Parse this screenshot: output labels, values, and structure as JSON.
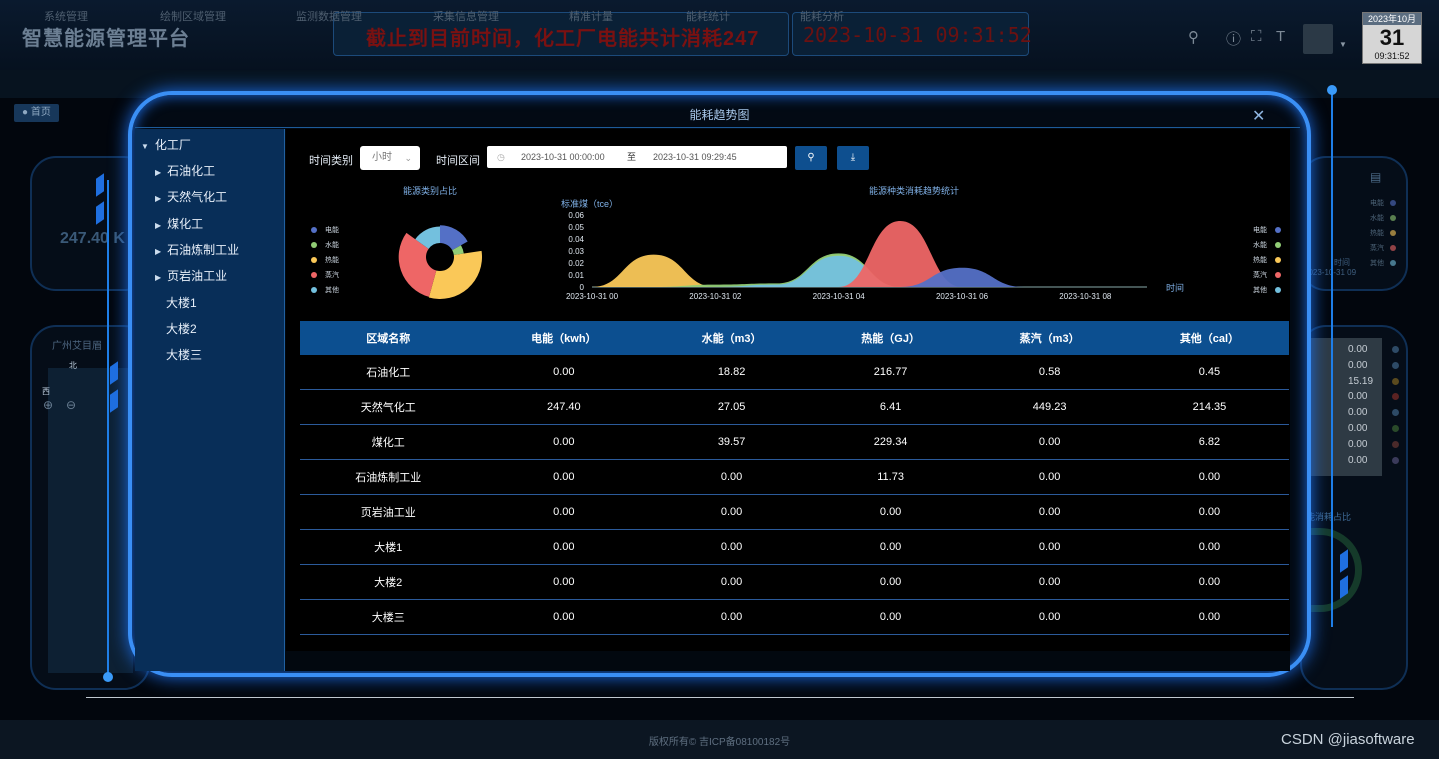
{
  "app": {
    "title": "智慧能源管理平台"
  },
  "marquee": {
    "text": "截止到目前时间，化工厂电能共计消耗247"
  },
  "clock": {
    "text": "2023-10-31 09:31:52"
  },
  "calendar": {
    "month": "2023年10月",
    "day": "31",
    "time": "09:31:52"
  },
  "nav": {
    "items": [
      "系统管理",
      "绘制区域管理",
      "监测数据管理",
      "采集信息管理",
      "精准计量",
      "能耗统计",
      "能耗分析"
    ]
  },
  "breadcrumb": {
    "label": "首页"
  },
  "background": {
    "value": "247.40 K",
    "block": "广州艾目眉",
    "compass_n": "北",
    "compass_w": "西"
  },
  "footer": {
    "copyright": "版权所有© 吉ICP备08100182号",
    "watermark": "CSDN @jiasoftware"
  },
  "modal": {
    "title": "能耗趋势图",
    "close": "✕"
  },
  "tree": {
    "root": "化工厂",
    "children": [
      {
        "label": "石油化工",
        "expandable": true
      },
      {
        "label": "天然气化工",
        "expandable": true
      },
      {
        "label": "煤化工",
        "expandable": true
      },
      {
        "label": "石油炼制工业",
        "expandable": true
      },
      {
        "label": "页岩油工业",
        "expandable": true
      },
      {
        "label": "大楼1",
        "expandable": false
      },
      {
        "label": "大楼2",
        "expandable": false
      },
      {
        "label": "大楼三",
        "expandable": false
      }
    ]
  },
  "filters": {
    "time_type_label": "时间类别",
    "time_type_value": "小时",
    "range_label": "时间区间",
    "range_start": "2023-10-31 00:00:00",
    "range_sep": "至",
    "range_end": "2023-10-31 09:29:45"
  },
  "colors": {
    "电能": "#5470c6",
    "水能": "#91cc75",
    "热能": "#fac858",
    "蒸汽": "#ee6666",
    "其他": "#73c0de"
  },
  "chart_data": [
    {
      "type": "pie",
      "title": "能源类别占比",
      "categories": [
        "电能",
        "水能",
        "热能",
        "蒸汽",
        "其他"
      ],
      "values": [
        247.4,
        85.44,
        464.25,
        449.81,
        221.62
      ]
    },
    {
      "type": "area",
      "title": "能源种类消耗趋势统计",
      "ylabel": "标准煤（tce）",
      "xlabel": "时间",
      "x": [
        "2023-10-31 00",
        "2023-10-31 01",
        "2023-10-31 02",
        "2023-10-31 03",
        "2023-10-31 04",
        "2023-10-31 05",
        "2023-10-31 06",
        "2023-10-31 07",
        "2023-10-31 08",
        "2023-10-31 09"
      ],
      "xticks": [
        "2023-10-31 00",
        "2023-10-31 02",
        "2023-10-31 04",
        "2023-10-31 06",
        "2023-10-31 08"
      ],
      "yticks": [
        "0",
        "0.01",
        "0.02",
        "0.03",
        "0.04",
        "0.05",
        "0.06"
      ],
      "ylim": [
        0,
        0.06
      ],
      "series": [
        {
          "name": "电能",
          "values": [
            0,
            0,
            0,
            0,
            0,
            0,
            0.016,
            0,
            0,
            0
          ]
        },
        {
          "name": "水能",
          "values": [
            0,
            0,
            0.002,
            0.003,
            0.028,
            0,
            0,
            0,
            0,
            0
          ]
        },
        {
          "name": "热能",
          "values": [
            0,
            0.027,
            0,
            0.001,
            0.027,
            0,
            0,
            0,
            0,
            0
          ]
        },
        {
          "name": "蒸汽",
          "values": [
            0,
            0,
            0,
            0,
            0,
            0.055,
            0,
            0,
            0,
            0
          ]
        },
        {
          "name": "其他",
          "values": [
            0,
            0,
            0,
            0.002,
            0.026,
            0,
            0,
            0,
            0,
            0
          ]
        }
      ]
    }
  ],
  "table": {
    "headers": [
      "区域名称",
      "电能（kwh）",
      "水能（m3）",
      "热能（GJ）",
      "蒸汽（m3）",
      "其他（cal）"
    ],
    "rows": [
      [
        "石油化工",
        "0.00",
        "18.82",
        "216.77",
        "0.58",
        "0.45"
      ],
      [
        "天然气化工",
        "247.40",
        "27.05",
        "6.41",
        "449.23",
        "214.35"
      ],
      [
        "煤化工",
        "0.00",
        "39.57",
        "229.34",
        "0.00",
        "6.82"
      ],
      [
        "石油炼制工业",
        "0.00",
        "0.00",
        "11.73",
        "0.00",
        "0.00"
      ],
      [
        "页岩油工业",
        "0.00",
        "0.00",
        "0.00",
        "0.00",
        "0.00"
      ],
      [
        "大楼1",
        "0.00",
        "0.00",
        "0.00",
        "0.00",
        "0.00"
      ],
      [
        "大楼2",
        "0.00",
        "0.00",
        "0.00",
        "0.00",
        "0.00"
      ],
      [
        "大楼三",
        "0.00",
        "0.00",
        "0.00",
        "0.00",
        "0.00"
      ]
    ]
  },
  "right_panel": {
    "values": [
      "0.00",
      "0.00",
      "15.19",
      "0.00",
      "0.00",
      "0.00",
      "0.00",
      "0.00"
    ],
    "legend": [
      "电能",
      "水能",
      "热能",
      "蒸汽",
      "其他"
    ],
    "time_label": "时间",
    "time_value": "2023-10-31 09",
    "ratio_label": "能消耗占比"
  }
}
